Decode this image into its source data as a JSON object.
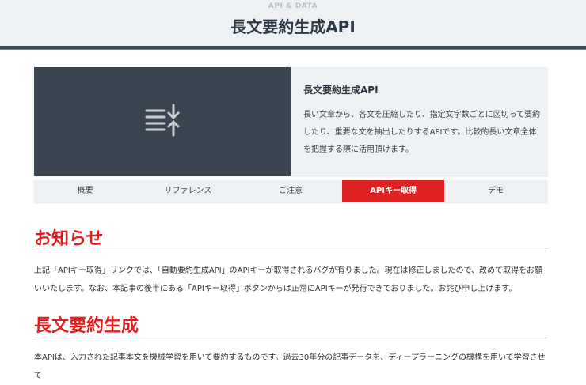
{
  "header": {
    "category": "API & DATA",
    "title": "長文要約生成API"
  },
  "card": {
    "icon": "summarize-icon",
    "title": "長文要約生成API",
    "description": "長い文章から、各文を圧縮したり、指定文字数ごとに区切って要約したり、重要な文を抽出したりするAPIです。比較的長い文章全体を把握する際に活用頂けます。"
  },
  "tabs": [
    {
      "label": "概要"
    },
    {
      "label": "リファレンス"
    },
    {
      "label": "ご注意"
    },
    {
      "label": "APIキー取得",
      "active": true
    },
    {
      "label": "デモ"
    }
  ],
  "sections": [
    {
      "heading": "お知らせ",
      "text": "上記「APIキー取得」リンクでは、「自動要約生成API」のAPIキーが取得されるバグが有りました。現在は修正しましたので、改めて取得をお願いいたします。なお、本記事の後半にある「APIキー取得」ボタンからは正常にAPIキーが発行できておりました。お詫び申し上げます。"
    },
    {
      "heading": "長文要約生成",
      "text": "本APIは、入力された記事本文を機械学習を用いて要約するものです。過去30年分の記事データを、ディープラーニングの機構を用いて学習させて"
    }
  ],
  "colors": {
    "accent": "#e02121",
    "dark": "#3a4551"
  }
}
